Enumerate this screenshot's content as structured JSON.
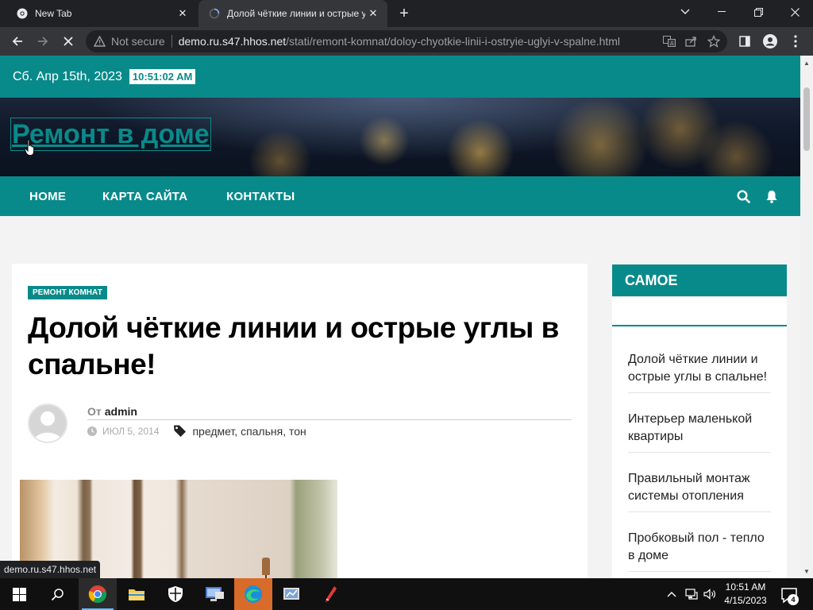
{
  "browser": {
    "tabs": [
      {
        "title": "New Tab",
        "active": false
      },
      {
        "title": "Долой чёткие линии и острые у",
        "active": true
      }
    ],
    "new_tab_label": "+",
    "url_security": "Not secure",
    "url_host": "demo.ru.s47.hhos.net",
    "url_path": "/stati/remont-komnat/doloy-chyotkie-linii-i-ostryie-uglyi-v-spalne.html",
    "status_url": "demo.ru.s47.hhos.net"
  },
  "site": {
    "date": "Сб. Апр 15th, 2023",
    "time": "10:51:02 AM",
    "title": "Ремонт в доме",
    "accent_color": "#098a8a",
    "nav": [
      "HOME",
      "КАРТА САЙТА",
      "КОНТАКТЫ"
    ]
  },
  "article": {
    "category": "РЕМОНТ КОМНАТ",
    "headline": "Долой чёткие линии и острые углы в спальне!",
    "by_label": "От",
    "author": "admin",
    "date": "ИЮЛ 5, 2014",
    "tags": "предмет, спальня, тон"
  },
  "sidebar": {
    "heading": "САМОЕ",
    "items": [
      "Долой чёткие линии и острые углы в спальне!",
      "Интерьер маленькой квартиры",
      "Правильный монтаж системы отопления",
      "Пробковый пол - тепло в доме"
    ]
  },
  "taskbar": {
    "time": "10:51 AM",
    "date": "4/15/2023",
    "notifications": "4"
  }
}
